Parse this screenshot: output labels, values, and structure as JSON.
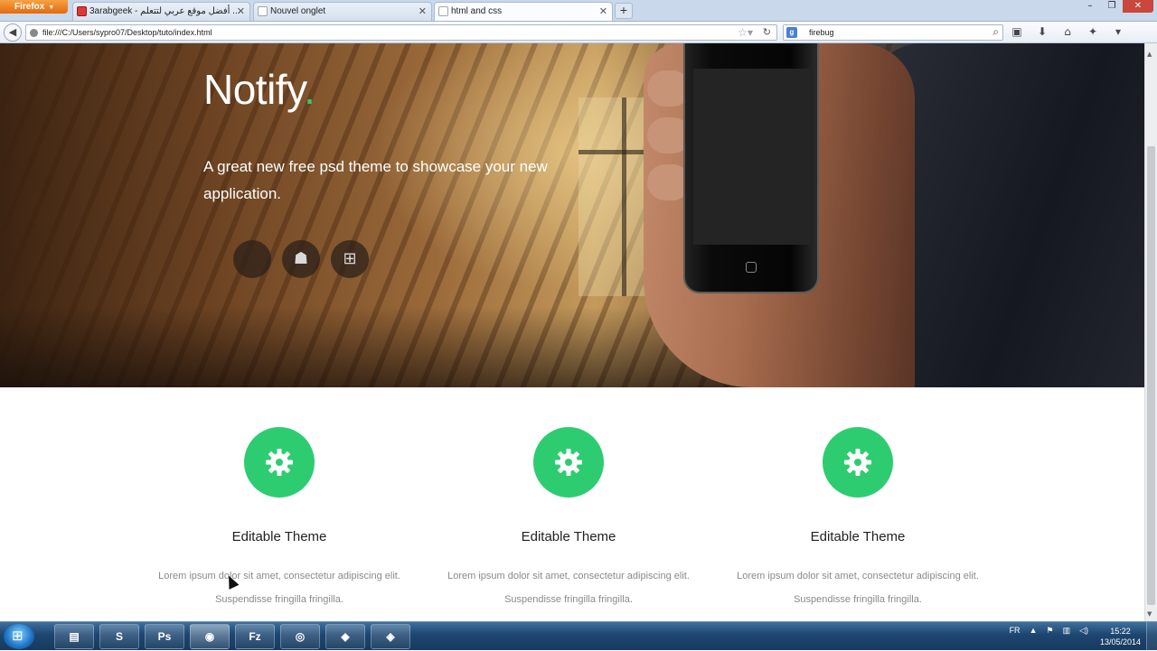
{
  "browser": {
    "menu_button": "Firefox",
    "tabs": [
      {
        "label": "3arabgeek - أفضل موقع عربي لتتعلم ...",
        "active": false
      },
      {
        "label": "Nouvel onglet",
        "active": false
      },
      {
        "label": "html and css",
        "active": true
      }
    ],
    "url": "file:///C:/Users/sypro07/Desktop/tuto/index.html",
    "search_value": "firebug"
  },
  "hero": {
    "brand_name": "Notify",
    "brand_dot": ".",
    "tagline": "A great new free psd theme to showcase your new application.",
    "platforms": [
      {
        "icon": "apple-icon",
        "glyph": ""
      },
      {
        "icon": "android-icon",
        "glyph": "☗"
      },
      {
        "icon": "windows-icon",
        "glyph": "⊞"
      }
    ],
    "accent_color": "#2ecc71"
  },
  "features": [
    {
      "icon": "gear-icon",
      "title": "Editable Theme",
      "text_line1": "Lorem ipsum dolor sit amet, consectetur adipiscing elit.",
      "text_line2": "Suspendisse fringilla fringilla."
    },
    {
      "icon": "gear-icon",
      "title": "Editable Theme",
      "text_line1": "Lorem ipsum dolor sit amet, consectetur adipiscing elit.",
      "text_line2": "Suspendisse fringilla fringilla."
    },
    {
      "icon": "gear-icon",
      "title": "Editable Theme",
      "text_line1": "Lorem ipsum dolor sit amet, consectetur adipiscing elit.",
      "text_line2": "Suspendisse fringilla fringilla."
    }
  ],
  "taskbar": {
    "apps": [
      {
        "name": "explorer",
        "glyph": "▤"
      },
      {
        "name": "sublime-text",
        "glyph": "S"
      },
      {
        "name": "photoshop",
        "glyph": "Ps"
      },
      {
        "name": "firefox",
        "glyph": "◉"
      },
      {
        "name": "filezilla",
        "glyph": "Fz"
      },
      {
        "name": "chrome",
        "glyph": "◎"
      },
      {
        "name": "app-7",
        "glyph": "◆"
      },
      {
        "name": "app-8",
        "glyph": "◈"
      }
    ],
    "language": "FR",
    "time": "15:22",
    "date": "13/05/2014"
  }
}
